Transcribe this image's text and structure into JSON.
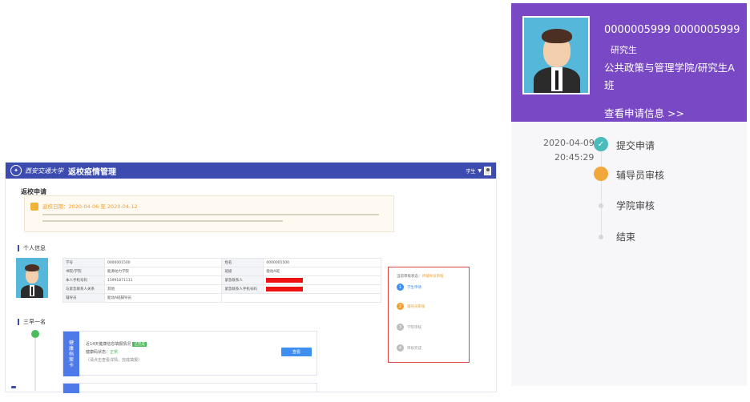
{
  "desktop": {
    "school_name": "西安交通大学",
    "system_title": "返校疫情管理",
    "user_menu": "学生",
    "page_title": "返校申请",
    "notice_date_range": "返校日期：2020-04-06 至 2020-04-12",
    "section_personal": "个人信息",
    "info_rows": [
      {
        "k1": "学号",
        "v1": "0000001500",
        "k2": "姓名",
        "v2": "0000001500"
      },
      {
        "k1": "书院/学院",
        "v1": "能源动力学院",
        "k2": "班级",
        "v2": "能动A班"
      },
      {
        "k1": "本人手机号码",
        "v1": "15991871111",
        "k2": "紧急联系人",
        "v2": ""
      },
      {
        "k1": "与紧急联系人关系",
        "v1": "其他",
        "k2": "紧急联系人手机号码",
        "v2": ""
      },
      {
        "k1": "辅导员",
        "v1": "能动A班辅导员",
        "k2": "",
        "v2": ""
      }
    ],
    "section_health": "三早一名",
    "status_title": "当前审核状态：",
    "status_value": "待辅导员审核",
    "status_steps": [
      {
        "num": "1",
        "label": "学生申请",
        "state": "done",
        "color": "#3f8ff0"
      },
      {
        "num": "2",
        "label": "辅导员审核",
        "state": "current",
        "color": "#f0a030"
      },
      {
        "num": "3",
        "label": "学院审核",
        "state": "pending",
        "color": "#bdbdbd"
      },
      {
        "num": "4",
        "label": "审核完成",
        "state": "pending",
        "color": "#bdbdbd"
      }
    ],
    "health_tab": [
      "健",
      "康",
      "档",
      "案",
      "卡"
    ],
    "health_line1": "近14天健康信息填报情况",
    "health_badge": "已完成",
    "health_line2_label": "健康码状态：",
    "health_line2_value": "正常",
    "health_line3": "（请点击查看详情，完成填报）",
    "health_button": "查看"
  },
  "mobile": {
    "student_id": "0000005999 0000005999",
    "role": "研究生",
    "school_class": "公共政策与管理学院/研究生A班",
    "view_link": "查看申请信息 >>",
    "timeline_date": "2020-04-09",
    "timeline_time": "20:45:29",
    "steps": [
      {
        "label": "提交申请",
        "state": "done"
      },
      {
        "label": "辅导员审核",
        "state": "current"
      },
      {
        "label": "学院审核",
        "state": "pending"
      },
      {
        "label": "结束",
        "state": "pending"
      }
    ]
  },
  "colors": {
    "header_blue": "#3c4bb0",
    "mobile_purple": "#7948c4",
    "done_teal": "#4bbcbb",
    "current_orange": "#f2a73b",
    "status_border_red": "#e04646"
  },
  "icons": [
    "school-logo-icon",
    "user-avatar-icon",
    "notice-icon",
    "check-icon",
    "caret-down-icon"
  ]
}
